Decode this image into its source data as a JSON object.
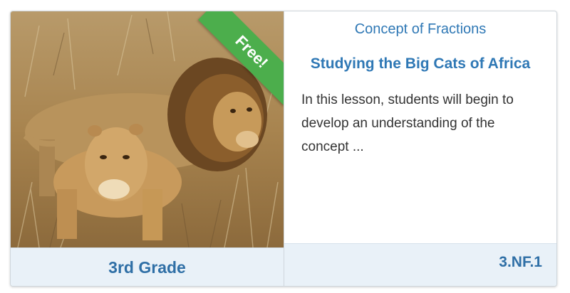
{
  "card": {
    "badge": "Free!",
    "category": "Concept of Fractions",
    "title": "Studying the Big Cats of Africa",
    "description": "In this lesson, students will begin to develop an understanding of the concept ...",
    "grade": "3rd Grade",
    "standard": "3.NF.1"
  },
  "colors": {
    "accent_blue": "#2f78b5",
    "badge_green": "#4cae4c",
    "footer_bg": "#e9f1f8"
  }
}
